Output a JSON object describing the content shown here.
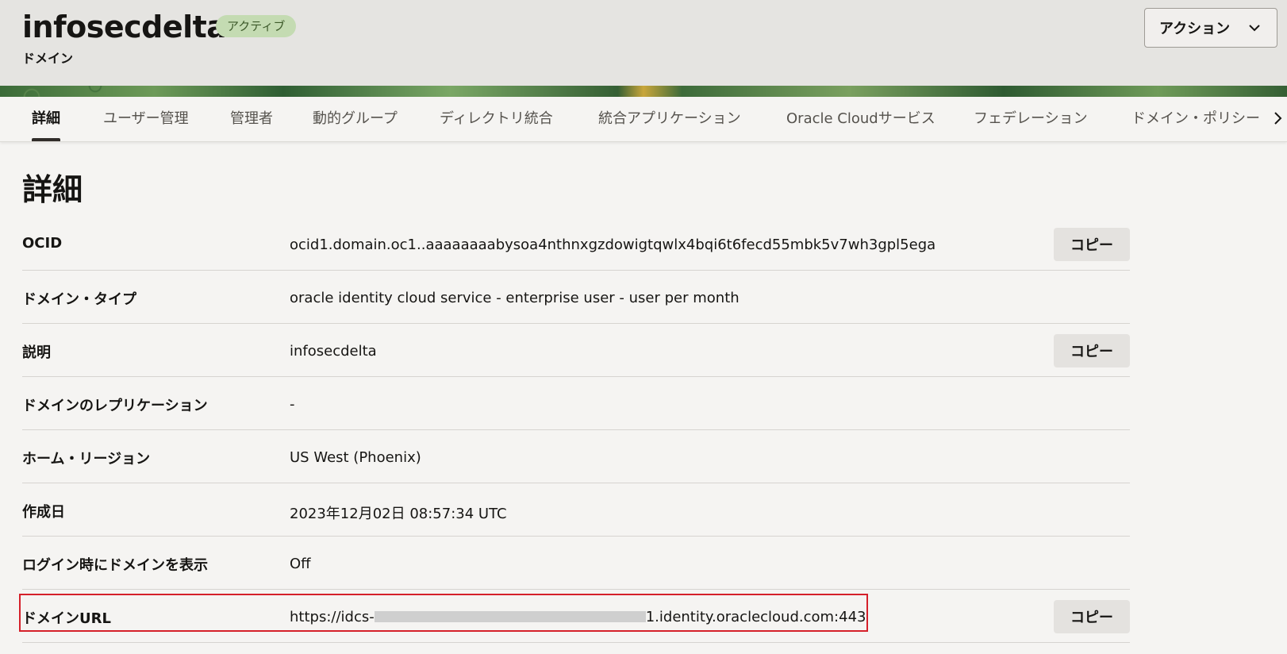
{
  "header": {
    "title": "infosecdelta",
    "status_badge": "アクティブ",
    "subtitle": "ドメイン",
    "action_button": "アクション",
    "action_icon": "chevron-down-icon"
  },
  "tabs": [
    {
      "label": "詳細",
      "active": true
    },
    {
      "label": "ユーザー管理",
      "active": false
    },
    {
      "label": "管理者",
      "active": false
    },
    {
      "label": "動的グループ",
      "active": false
    },
    {
      "label": "ディレクトリ統合",
      "active": false
    },
    {
      "label": "統合アプリケーション",
      "active": false
    },
    {
      "label": "Oracle Cloudサービス",
      "active": false
    },
    {
      "label": "フェデレーション",
      "active": false
    },
    {
      "label": "ドメイン・ポリシー",
      "active": false
    }
  ],
  "tab_scroll_icon": "chevron-right-icon",
  "details": {
    "title": "詳細",
    "copy_label": "コピー",
    "rows": [
      {
        "label": "OCID",
        "value": "ocid1.domain.oc1..aaaaaaaabysoa4nthnxgzdowigtqwlx4bqi6t6fecd55mbk5v7wh3gpl5ega",
        "copy": true
      },
      {
        "label": "ドメイン・タイプ",
        "value": "oracle identity cloud service - enterprise user - user per month",
        "copy": false
      },
      {
        "label": "説明",
        "value": "infosecdelta",
        "copy": true
      },
      {
        "label": "ドメインのレプリケーション",
        "value": "-",
        "copy": false
      },
      {
        "label": "ホーム・リージョン",
        "value": "US West (Phoenix)",
        "copy": false
      },
      {
        "label": "作成日",
        "value": "2023年12月02日 08:57:34 UTC",
        "copy": false
      },
      {
        "label": "ログイン時にドメインを表示",
        "value": "Off",
        "copy": false
      },
      {
        "label": "ドメインURL",
        "value_prefix": "https://idcs-",
        "value_suffix": "1.identity.oraclecloud.com:443",
        "copy": true
      }
    ]
  },
  "colors": {
    "highlight_border": "#d5202a",
    "badge_bg": "#c4dbb2",
    "active_tab_indicator": "#312d2a"
  }
}
